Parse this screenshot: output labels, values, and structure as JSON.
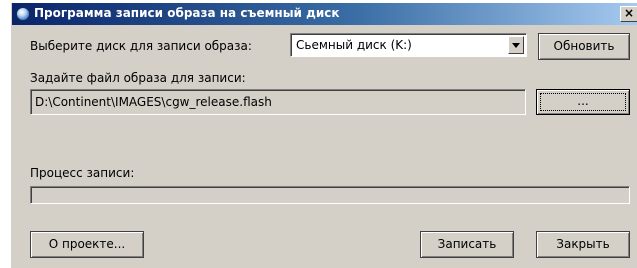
{
  "window": {
    "title": "Программа записи образа на съемный диск",
    "close_glyph": "×"
  },
  "disk": {
    "label": "Выберите диск для записи образа:",
    "selected": "Сьемный диск (K:)",
    "refresh_label": "Обновить"
  },
  "file": {
    "label": "Задайте файл образа для записи:",
    "path": "D:\\Continent\\IMAGES\\cgw_release.flash",
    "browse_label": "..."
  },
  "progress": {
    "label": "Процесс записи:",
    "value": 0
  },
  "buttons": {
    "about": "О проекте...",
    "write": "Записать",
    "close": "Закрыть"
  },
  "colors": {
    "face": "#d4d0c8",
    "title_start": "#0a246a",
    "title_end": "#a6caf0"
  },
  "icons": {
    "title": "disc-icon",
    "combo": "chevron-down-icon"
  }
}
